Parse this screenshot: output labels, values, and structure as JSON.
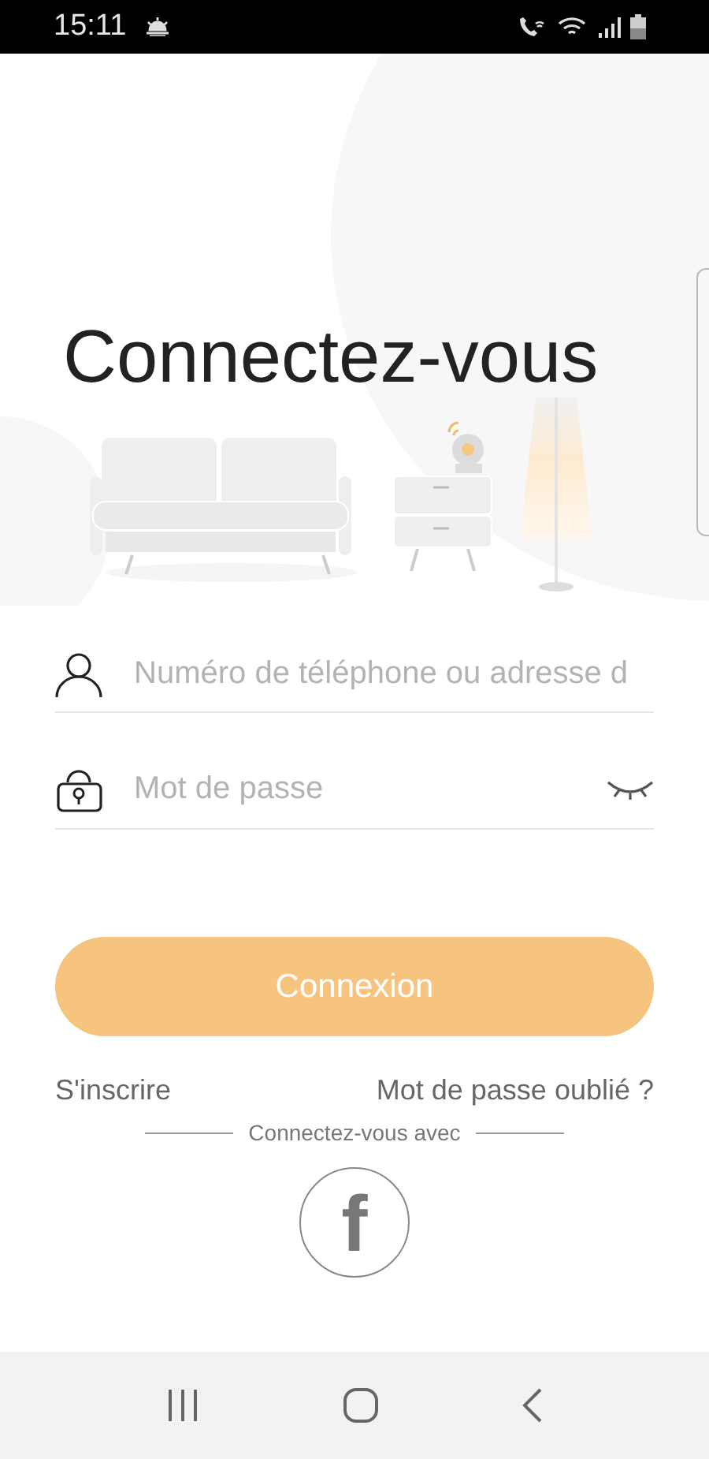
{
  "status_bar": {
    "time": "15:11"
  },
  "title": "Connectez-vous",
  "fields": [
    {
      "kind": "account",
      "placeholder": "Numéro de téléphone ou adresse d"
    },
    {
      "kind": "password",
      "placeholder": "Mot de passe"
    }
  ],
  "login_button": "Connexion",
  "links": {
    "register": "S'inscrire",
    "forgot": "Mot de passe oublié ?"
  },
  "divider_text": "Connectez-vous avec",
  "social_button": "f"
}
